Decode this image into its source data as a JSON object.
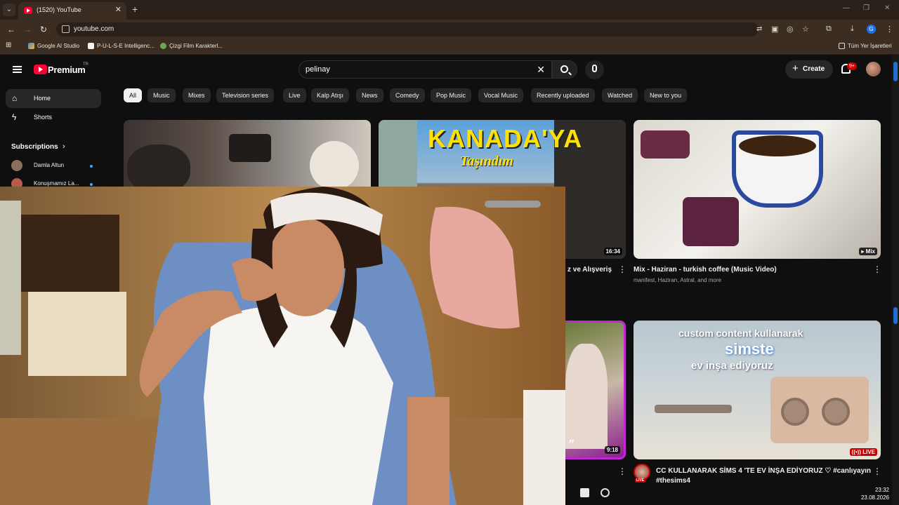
{
  "browser": {
    "tab_title": "(1520) YouTube",
    "tab_close": "✕",
    "new_tab": "+",
    "url": "youtube.com",
    "bookmarks": [
      "Google AI Studio",
      "P-U-L-S-E Intelligenc...",
      "Çizgi Film Karakterl..."
    ],
    "all_bookmarks": "Tüm Yer İşaretleri",
    "profile_initial": "G"
  },
  "yt": {
    "logo_text": "Premium",
    "logo_tr": "TR",
    "search_value": "pelinay",
    "create_label": "Create",
    "notif_badge": "9+",
    "sidebar": {
      "home": "Home",
      "shorts": "Shorts",
      "subscriptions": "Subscriptions",
      "subs": [
        "Damla Altun",
        "Konuşmamız La..."
      ]
    },
    "chips": [
      "All",
      "Music",
      "Mixes",
      "Television series",
      "Live",
      "Kalp Atışı",
      "News",
      "Comedy",
      "Pop Music",
      "Vocal Music",
      "Recently uploaded",
      "Watched",
      "New to you"
    ],
    "videos": {
      "v2_overlay_title": "KANADA'YA",
      "v2_overlay_sub": "Taşındım",
      "v2_duration": "16:34",
      "v2_title_fragment": "z ve Alışveriş",
      "v3_mix_badge": "Mix",
      "v3_title": "Mix - Haziran - turkish coffee (Music Video)",
      "v3_meta": "manifest, Haziran, Astral, and more",
      "v5_duration": "9:18",
      "v6_overlay_line1": "custom content kullanarak",
      "v6_overlay_line2": "simste",
      "v6_overlay_line3": "ev inşa ediyoruz",
      "v6_live": "LIVE",
      "v6_title_line1": "CC KULLANARAK SİMS 4 'TE EV İNŞA EDİYORUZ ♡ #canlıyayın",
      "v6_title_line2": "#thesims4",
      "channel_live_badge": "LIVE"
    }
  },
  "taskbar": {
    "time": "23:32",
    "date": "23.08.2026"
  },
  "colors": {
    "yt_red": "#ff0033",
    "chrome_brown": "#3b2d22",
    "bg": "#0f0f0f"
  }
}
